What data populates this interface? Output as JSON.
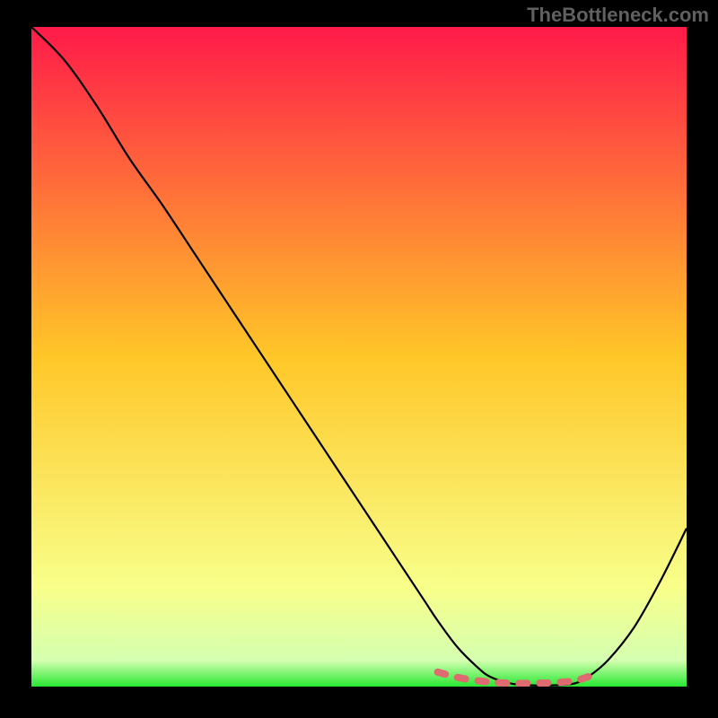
{
  "watermark": "TheBottleneck.com",
  "chart_data": {
    "type": "line",
    "title": "",
    "xlabel": "",
    "ylabel": "",
    "xlim": [
      0,
      100
    ],
    "ylim": [
      0,
      100
    ],
    "grid": false,
    "legend": false,
    "gradient_stops": [
      {
        "offset": 0,
        "color": "#ff1a4a"
      },
      {
        "offset": 50,
        "color": "#ffc728"
      },
      {
        "offset": 85,
        "color": "#f8ff8a"
      },
      {
        "offset": 96,
        "color": "#d5ffb0"
      },
      {
        "offset": 100,
        "color": "#27e833"
      }
    ],
    "series": [
      {
        "name": "bottleneck-curve",
        "color": "#000000",
        "x": [
          0,
          5,
          10,
          15,
          20,
          25,
          30,
          35,
          40,
          45,
          50,
          55,
          60,
          62,
          65,
          68,
          70,
          73,
          76,
          80,
          83,
          85,
          88,
          92,
          96,
          100
        ],
        "y": [
          100,
          95,
          88,
          80,
          73,
          65.5,
          58,
          50.5,
          43,
          35.5,
          28,
          20.5,
          13,
          10,
          6,
          3,
          1.5,
          0.5,
          0.2,
          0.2,
          0.5,
          1.5,
          4,
          9,
          16,
          24
        ]
      },
      {
        "name": "optimal-region",
        "color": "#dd6b6f",
        "style": "dashed-thick",
        "x": [
          62,
          65,
          68,
          70,
          73,
          76,
          80,
          83,
          85
        ],
        "y": [
          2.2,
          1.4,
          0.9,
          0.7,
          0.5,
          0.5,
          0.6,
          0.9,
          1.5
        ]
      }
    ]
  }
}
